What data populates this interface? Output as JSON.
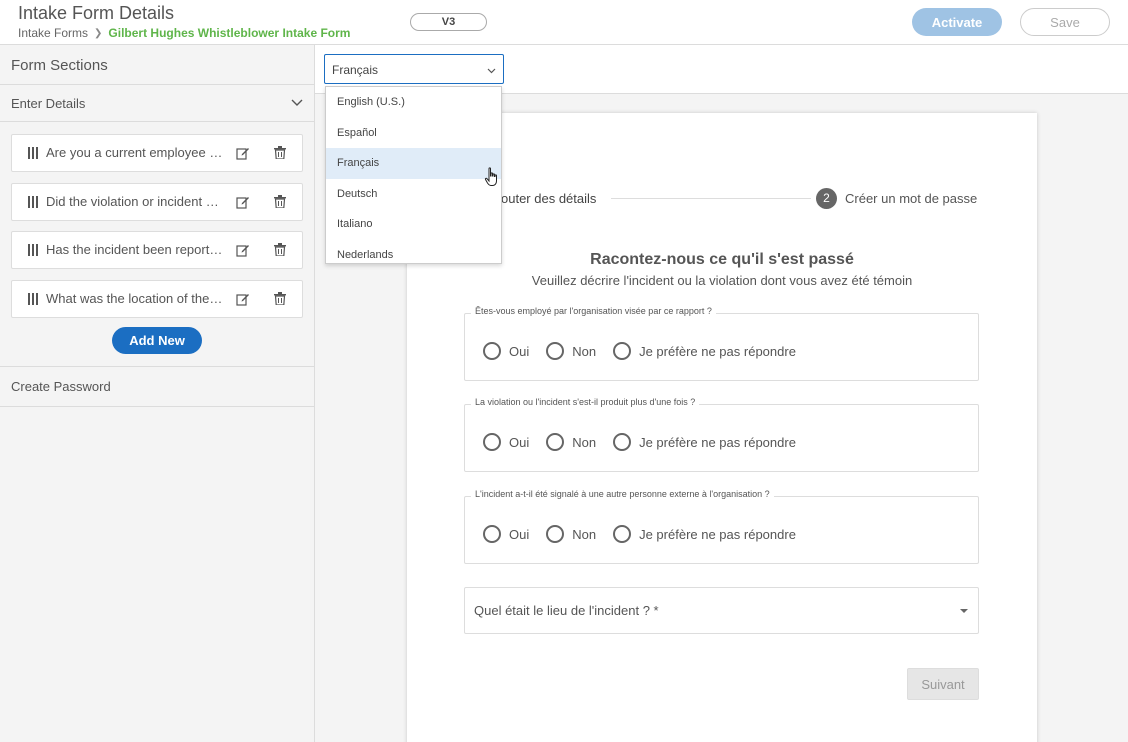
{
  "header": {
    "title": "Intake Form Details",
    "breadcrumb_root": "Intake Forms",
    "breadcrumb_current": "Gilbert Hughes Whistleblower Intake Form",
    "version": "V3",
    "activate_label": "Activate",
    "save_label": "Save"
  },
  "sidebar": {
    "title": "Form Sections",
    "section_enter": "Enter Details",
    "items": [
      {
        "label": "Are you a current employee of the organization"
      },
      {
        "label": "Did the violation or incident occur more than once?"
      },
      {
        "label": "Has the incident been reported to anyone?"
      },
      {
        "label": "What was the location of the incident?"
      }
    ],
    "add_new_label": "Add New",
    "section_create": "Create Password"
  },
  "language": {
    "selected": "Français",
    "options": [
      "English (U.S.)",
      "Español",
      "Français",
      "Deutsch",
      "Italiano",
      "Nederlands"
    ]
  },
  "form": {
    "step1_label": "outer des détails",
    "step2_num": "2",
    "step2_label": "Créer un mot de passe",
    "heading": "Racontez-nous ce qu'il s'est passé",
    "subheading": "Veuillez décrire l'incident ou la violation dont vous avez été témoin",
    "questions": [
      {
        "legend": "Êtes-vous employé par l'organisation visée par ce rapport ?",
        "options": [
          "Oui",
          "Non",
          "Je préfère ne pas répondre"
        ]
      },
      {
        "legend": "La violation ou l'incident s'est-il produit plus d'une fois ?",
        "options": [
          "Oui",
          "Non",
          "Je préfère ne pas répondre"
        ]
      },
      {
        "legend": "L'incident a-t-il été signalé à une autre personne externe à l'organisation ?",
        "options": [
          "Oui",
          "Non",
          "Je préfère ne pas répondre"
        ]
      }
    ],
    "location_label": "Quel était le lieu de l'incident ? *",
    "next_label": "Suivant"
  },
  "colors": {
    "accent": "#1b6ec2",
    "breadcrumb_current": "#5fb54a",
    "activate_disabled": "#9fc3e4"
  }
}
